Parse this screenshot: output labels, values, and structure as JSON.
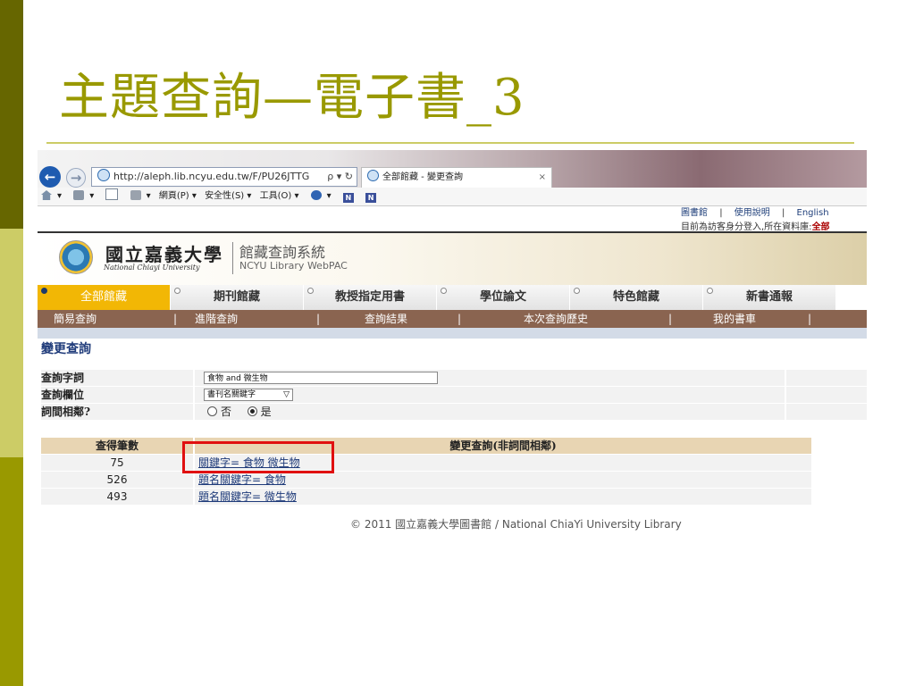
{
  "slide": {
    "title": "主題查詢—電子書_3"
  },
  "browser": {
    "address": "http://aleph.lib.ncyu.edu.tw/F/PU26JTTG",
    "address_tools": "ρ ▾ ↻",
    "tab_title": "全部館藏 - 變更查詢",
    "tab_close": "×",
    "cmd_page": "網頁(P) ▾",
    "cmd_security": "安全性(S) ▾",
    "cmd_tools": "工具(O) ▾",
    "cmd_help": "▾",
    "n_label": "N"
  },
  "header": {
    "link_library": "圖書館",
    "link_help": "使用說明",
    "link_english": "English",
    "sep": "|",
    "login_prefix": "目前為訪客身分登入,所在資料庫:",
    "login_db": "全部"
  },
  "banner": {
    "uni_cn": "國立嘉義大學",
    "uni_en": "National Chiayi University",
    "sys_cn": "館藏查詢系統",
    "sys_en": "NCYU Library WebPAC"
  },
  "main_tabs": [
    "全部館藏",
    "期刊館藏",
    "教授指定用書",
    "學位論文",
    "特色館藏",
    "新書通報"
  ],
  "sub_nav": [
    "簡易查詢",
    "進階查詢",
    "查詢結果",
    "本次查詢歷史",
    "我的書車"
  ],
  "sub_sep": "|",
  "section_title": "變更查詢",
  "form": {
    "query_label": "查詢字詞",
    "query_value": "食物 and 微生物",
    "field_label": "查詢欄位",
    "field_value": "書刊名關鍵字",
    "adjacent_label": "詞間相鄰?",
    "opt_no": "否",
    "opt_yes": "是"
  },
  "results": {
    "col_count": "查得筆數",
    "col_query": "變更查詢(非詞間相鄰)",
    "rows": [
      {
        "count": "75",
        "query": "關鍵字= 食物 微生物"
      },
      {
        "count": "526",
        "query": "題名關鍵字= 食物"
      },
      {
        "count": "493",
        "query": "題名關鍵字= 微生物"
      }
    ]
  },
  "footer": "© 2011 國立嘉義大學圖書館 / National ChiaYi University Library",
  "colors": {
    "accent": "#999900",
    "tab_active": "#f2b705",
    "subnav": "#8a6450",
    "highlight": "#e01010"
  }
}
